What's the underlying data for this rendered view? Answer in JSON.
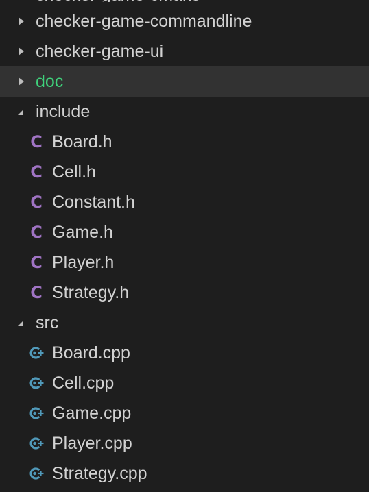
{
  "explorer": {
    "partial_top_item": "checker-game-cmake",
    "items": [
      {
        "type": "folder",
        "label": "checker-game-commandline",
        "state": "collapsed",
        "name": "folder-checker-game-commandline"
      },
      {
        "type": "folder",
        "label": "checker-game-ui",
        "state": "collapsed",
        "name": "folder-checker-game-ui"
      },
      {
        "type": "folder",
        "label": "doc",
        "state": "collapsed",
        "selected": true,
        "color": "#3fd17b",
        "name": "folder-doc"
      },
      {
        "type": "folder",
        "label": "include",
        "state": "expanded",
        "name": "folder-include"
      },
      {
        "type": "file",
        "label": "Board.h",
        "icon": "c-header-icon",
        "name": "file-board-h"
      },
      {
        "type": "file",
        "label": "Cell.h",
        "icon": "c-header-icon",
        "name": "file-cell-h"
      },
      {
        "type": "file",
        "label": "Constant.h",
        "icon": "c-header-icon",
        "name": "file-constant-h"
      },
      {
        "type": "file",
        "label": "Game.h",
        "icon": "c-header-icon",
        "name": "file-game-h"
      },
      {
        "type": "file",
        "label": "Player.h",
        "icon": "c-header-icon",
        "name": "file-player-h"
      },
      {
        "type": "file",
        "label": "Strategy.h",
        "icon": "c-header-icon",
        "name": "file-strategy-h"
      },
      {
        "type": "folder",
        "label": "src",
        "state": "expanded",
        "name": "folder-src"
      },
      {
        "type": "file",
        "label": "Board.cpp",
        "icon": "cpp-source-icon",
        "name": "file-board-cpp"
      },
      {
        "type": "file",
        "label": "Cell.cpp",
        "icon": "cpp-source-icon",
        "name": "file-cell-cpp"
      },
      {
        "type": "file",
        "label": "Game.cpp",
        "icon": "cpp-source-icon",
        "name": "file-game-cpp"
      },
      {
        "type": "file",
        "label": "Player.cpp",
        "icon": "cpp-source-icon",
        "name": "file-player-cpp"
      },
      {
        "type": "file",
        "label": "Strategy.cpp",
        "icon": "cpp-source-icon",
        "name": "file-strategy-cpp"
      }
    ]
  },
  "colors": {
    "background": "#1e1e1e",
    "selected_row": "#323232",
    "text": "#d2d2d2",
    "modified_green": "#3fd17b",
    "c_icon": "#a074c4",
    "cpp_icon": "#519aba"
  }
}
